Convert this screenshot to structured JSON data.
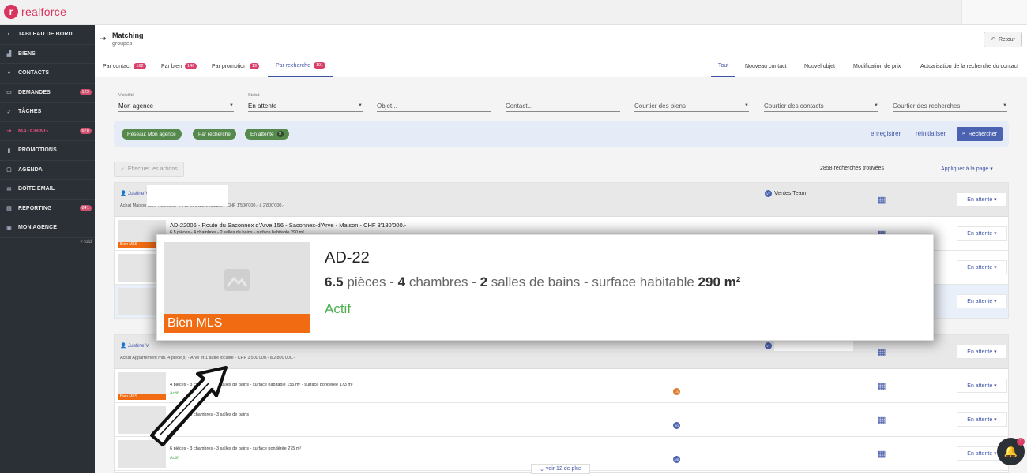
{
  "brand": {
    "name": "realforce",
    "color": "#d8345f"
  },
  "sidebar": {
    "items": [
      {
        "label": "TABLEAU DE BORD",
        "icon": "dashboard-icon",
        "glyph": "◐"
      },
      {
        "label": "BIENS",
        "icon": "buildings-icon",
        "glyph": "▟"
      },
      {
        "label": "CONTACTS",
        "icon": "user-icon",
        "glyph": "●"
      },
      {
        "label": "DEMANDES",
        "icon": "chat-icon",
        "glyph": "▭",
        "badge": "129"
      },
      {
        "label": "TÂCHES",
        "icon": "check-circle-icon",
        "glyph": "✓"
      },
      {
        "label": "MATCHING",
        "icon": "matching-icon",
        "glyph": "⇢",
        "badge": "678",
        "active": true
      },
      {
        "label": "PROMOTIONS",
        "icon": "chart-icon",
        "glyph": "▮"
      },
      {
        "label": "AGENDA",
        "icon": "calendar-icon",
        "glyph": "▢"
      },
      {
        "label": "BOÎTE EMAIL",
        "icon": "mail-icon",
        "glyph": "✉"
      },
      {
        "label": "REPORTING",
        "icon": "report-icon",
        "glyph": "▤",
        "badge": "841"
      },
      {
        "label": "MON AGENCE",
        "icon": "agency-icon",
        "glyph": "▣"
      }
    ],
    "fold_label": "< fold"
  },
  "header": {
    "title": "Matching",
    "subtitle": "groupes",
    "back_label": "Retour"
  },
  "tabs": {
    "left": [
      {
        "label": "Par contact",
        "badge": "162"
      },
      {
        "label": "Par bien",
        "badge": "146"
      },
      {
        "label": "Par promotion",
        "badge": "19"
      },
      {
        "label": "Par recherche",
        "badge": "191",
        "active": true
      }
    ],
    "right": [
      {
        "label": "Tout",
        "active": true
      },
      {
        "label": "Nouveau contact"
      },
      {
        "label": "Nouvel objet"
      },
      {
        "label": "Modification de prix"
      },
      {
        "label": "Actualisation de la recherche du contact"
      }
    ]
  },
  "filters": {
    "visibility": {
      "label": "Visibilité",
      "value": "Mon agence"
    },
    "status": {
      "label": "Statut",
      "value": "En attente"
    },
    "object": {
      "placeholder": "Objet..."
    },
    "contact": {
      "placeholder": "Contact..."
    },
    "broker_goods": {
      "placeholder": "Courtier des biens"
    },
    "broker_contacts": {
      "placeholder": "Courtier des contacts"
    },
    "broker_searches": {
      "placeholder": "Courtier des recherches"
    }
  },
  "chips": [
    "Réseau: Mon agence",
    "Par recherche",
    "En attente"
  ],
  "chip_actions": {
    "save": "enregistrer",
    "reset": "réinitialiser",
    "search": "Rechercher"
  },
  "toolbar": {
    "actions": "Effectuer les actions",
    "count": "2858 recherches trouvées",
    "apply": "Appliquer à la page"
  },
  "group1": {
    "person": "Justine V",
    "desc": "Achat Maison min. 4 pièce(s) - Arve et 1 autre localité - CHF 1'500'000.- à 2'800'000.-",
    "team": "Ventes Team",
    "team_initials": "VT",
    "status": "En attente",
    "rows": [
      {
        "title": "AD-22006 - Route du Saconnex d'Arve 156 - Saconnex-d'Arve - Maison - CHF 3'180'000.-",
        "desc": "6.5 pièces - 4 chambres - 2 salles de bains - surface habitable 290 m²",
        "mls": "Bien MLS",
        "status": "En attente"
      },
      {
        "status": "En attente"
      },
      {
        "status": "En attente"
      }
    ]
  },
  "group2": {
    "person": "Justine V",
    "desc": "Achat Appartement min. 4 pièce(s) - Arve et 1 autre localité - CHF 1'500'000.- à 2'800'000.-",
    "team_initials": "VT",
    "status": "En attente",
    "rows": [
      {
        "desc": "4 pièces - 3 chambres - 1 salles de bains - surface habitable 155 m² - surface pondérée 173 m²",
        "state": "Actif",
        "mls": "Bien MLS",
        "avatar": "LS",
        "avatar_color": "#e07a2f",
        "status": "En attente"
      },
      {
        "desc": "4 pièces - 3 chambres - 3 salles de bains",
        "state": "Actif",
        "avatar": "JG",
        "avatar_color": "#4b62b0",
        "status": "En attente"
      },
      {
        "desc": "6 pièces - 3 chambres - 3 salles de bains - surface pondérée 275 m²",
        "state": "Actif",
        "avatar": "MB",
        "avatar_color": "#4b62b0",
        "status": "En attente"
      }
    ]
  },
  "more": "voir 12 de plus",
  "notification_count": "1",
  "zoom": {
    "title": "AD-22",
    "desc_parts": [
      "6.5",
      " pièces - ",
      "4",
      " chambres - ",
      "2",
      " salles de bains - surface habitable ",
      "290 m²"
    ],
    "state": "Actif",
    "mls": "Bien MLS"
  }
}
